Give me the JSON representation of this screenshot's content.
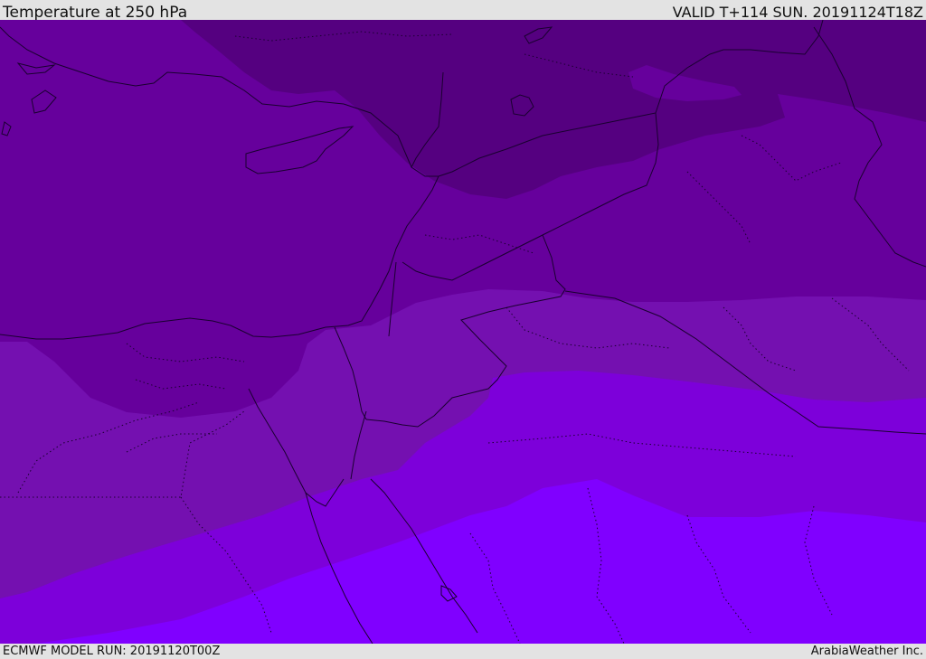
{
  "header": {
    "title": "Temperature at 250 hPa",
    "valid_time": "VALID T+114 SUN. 20191124T18Z"
  },
  "footer": {
    "model_run": "ECMWF MODEL RUN: 20191120T00Z",
    "credit": "ArabiaWeather Inc."
  },
  "map": {
    "field": "temperature",
    "level": "250 hPa",
    "colors": {
      "band_coldest": "#550080",
      "band_2": "#66009c",
      "band_3": "#7410b0",
      "band_4": "#7d00da",
      "band_warmest": "#8000ff",
      "coastline": "#1a0030",
      "border": "#1a0030"
    }
  }
}
